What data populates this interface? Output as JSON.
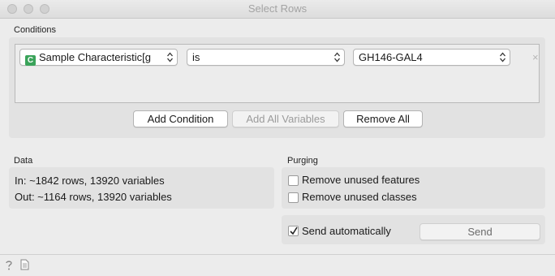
{
  "window": {
    "title": "Select Rows"
  },
  "conditions": {
    "section_label": "Conditions",
    "row": {
      "variable": {
        "chip": "C",
        "label": "Sample Characteristic[g"
      },
      "operator": "is",
      "value": "GH146-GAL4",
      "remove_glyph": "×"
    },
    "buttons": {
      "add_condition": "Add Condition",
      "add_all_variables": "Add All Variables",
      "remove_all": "Remove All"
    }
  },
  "data": {
    "section_label": "Data",
    "in_text": "In: ~1842 rows, 13920 variables",
    "out_text": "Out: ~1164 rows, 13920 variables"
  },
  "purging": {
    "section_label": "Purging",
    "remove_unused_features": {
      "label": "Remove unused features",
      "checked": false
    },
    "remove_unused_classes": {
      "label": "Remove unused classes",
      "checked": false
    }
  },
  "commit": {
    "send_automatically": {
      "label": "Send automatically",
      "checked": true
    },
    "send_button": "Send"
  },
  "icons": {
    "help": "help-icon",
    "report": "report-icon"
  }
}
